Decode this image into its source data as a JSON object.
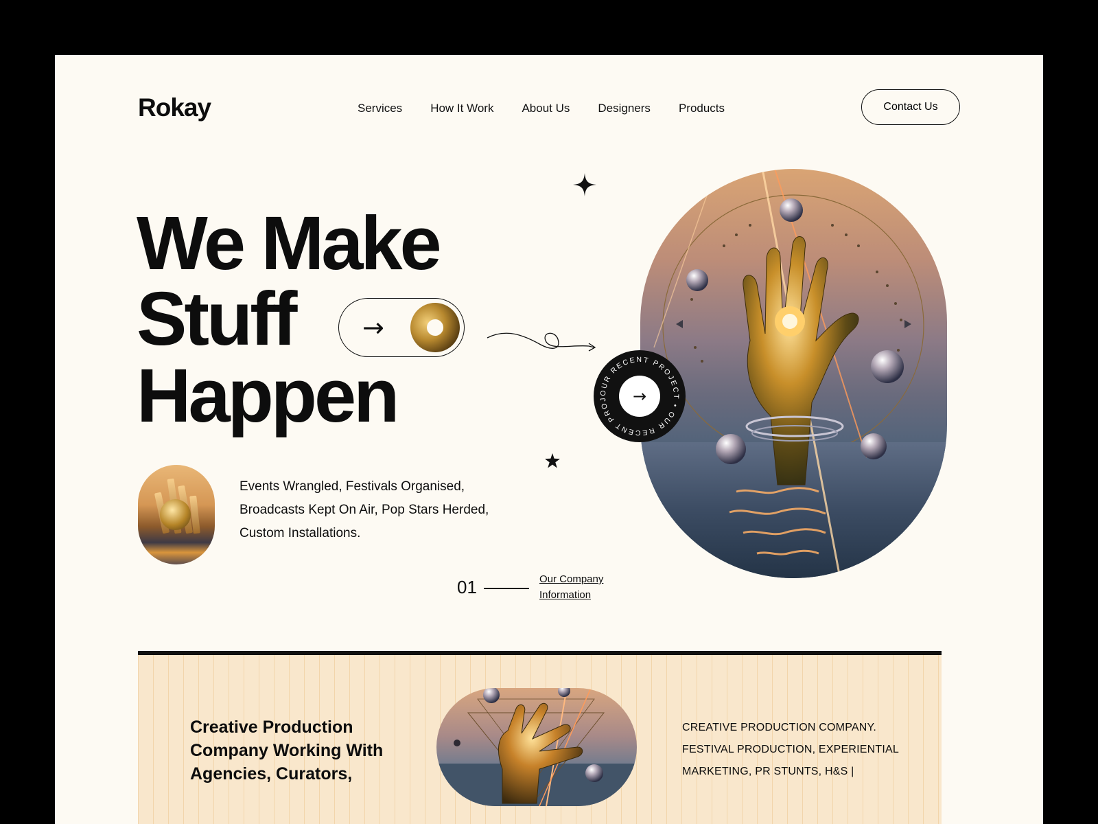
{
  "brand": {
    "logo": "Rokay"
  },
  "nav": {
    "items": [
      "Services",
      "How It Work",
      "About Us",
      "Designers",
      "Products"
    ],
    "contact_label": "Contact Us"
  },
  "hero": {
    "line1": "We Make",
    "line2": "Stuff",
    "line3": "Happen",
    "tagline": "Events Wrangled, Festivals Organised, Broadcasts Kept On Air, Pop Stars Herded, Custom Installations.",
    "counter": "01",
    "link_line1": "Our Company",
    "link_line2": "Information",
    "badge_text": "OUR RECENT PROJECT • OUR RECENT PROJECT •"
  },
  "band": {
    "title": "Creative Production Company Working With Agencies, Curators,",
    "copy": "CREATIVE PRODUCTION COMPANY. FESTIVAL PRODUCTION, EXPERIENTIAL MARKETING, PR STUNTS, H&S |"
  },
  "icons": {
    "arrow": "arrow-right-icon",
    "sparkle": "four-point-star-icon",
    "star": "star-icon"
  }
}
